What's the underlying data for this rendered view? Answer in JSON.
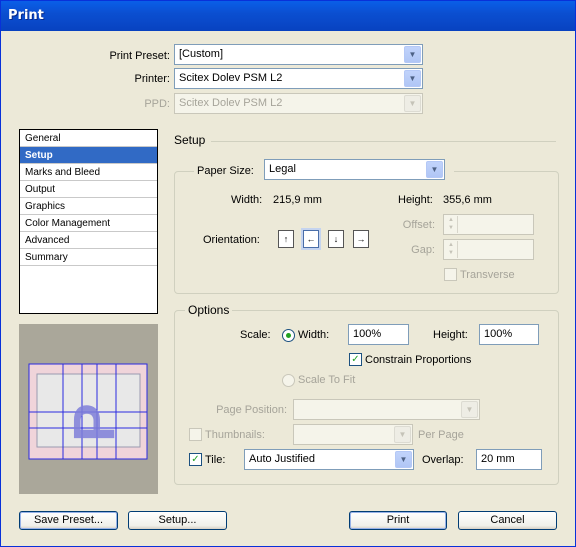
{
  "window": {
    "title": "Print"
  },
  "header": {
    "print_preset_label": "Print Preset:",
    "print_preset_value": "[Custom]",
    "printer_label": "Printer:",
    "printer_value": "Scitex Dolev PSM L2",
    "ppd_label": "PPD:",
    "ppd_value": "Scitex Dolev PSM L2"
  },
  "sidebar": {
    "items": [
      {
        "label": "General"
      },
      {
        "label": "Setup"
      },
      {
        "label": "Marks and Bleed"
      },
      {
        "label": "Output"
      },
      {
        "label": "Graphics"
      },
      {
        "label": "Color Management"
      },
      {
        "label": "Advanced"
      },
      {
        "label": "Summary"
      }
    ],
    "selected": "Setup"
  },
  "setup": {
    "section_title": "Setup",
    "paper_size_label": "Paper Size:",
    "paper_size_value": "Legal",
    "width_label": "Width:",
    "width_value": "215,9 mm",
    "height_label": "Height:",
    "height_value": "355,6 mm",
    "offset_label": "Offset:",
    "gap_label": "Gap:",
    "transverse_label": "Transverse",
    "orientation_label": "Orientation:",
    "orientation_icons": [
      "portrait-icon",
      "landscape-icon",
      "reverse-portrait-icon",
      "reverse-landscape-icon"
    ]
  },
  "options": {
    "title": "Options",
    "scale_label": "Scale:",
    "scale_width_label": "Width:",
    "scale_width_value": "100%",
    "scale_height_label": "Height:",
    "scale_height_value": "100%",
    "constrain_label": "Constrain Proportions",
    "constrain_checked": true,
    "scale_to_fit_label": "Scale To Fit",
    "page_position_label": "Page Position:",
    "thumbnails_label": "Thumbnails:",
    "per_page_label": "Per Page",
    "tile_label": "Tile:",
    "tile_checked": true,
    "tile_value": "Auto Justified",
    "overlap_label": "Overlap:",
    "overlap_value": "20 mm"
  },
  "preview": {
    "letter": "P"
  },
  "footer": {
    "save_preset": "Save Preset...",
    "setup": "Setup...",
    "print": "Print",
    "cancel": "Cancel"
  },
  "colors": {
    "title_bar": "#0b4fd1",
    "selection": "#316ac5",
    "check": "#21a121"
  }
}
